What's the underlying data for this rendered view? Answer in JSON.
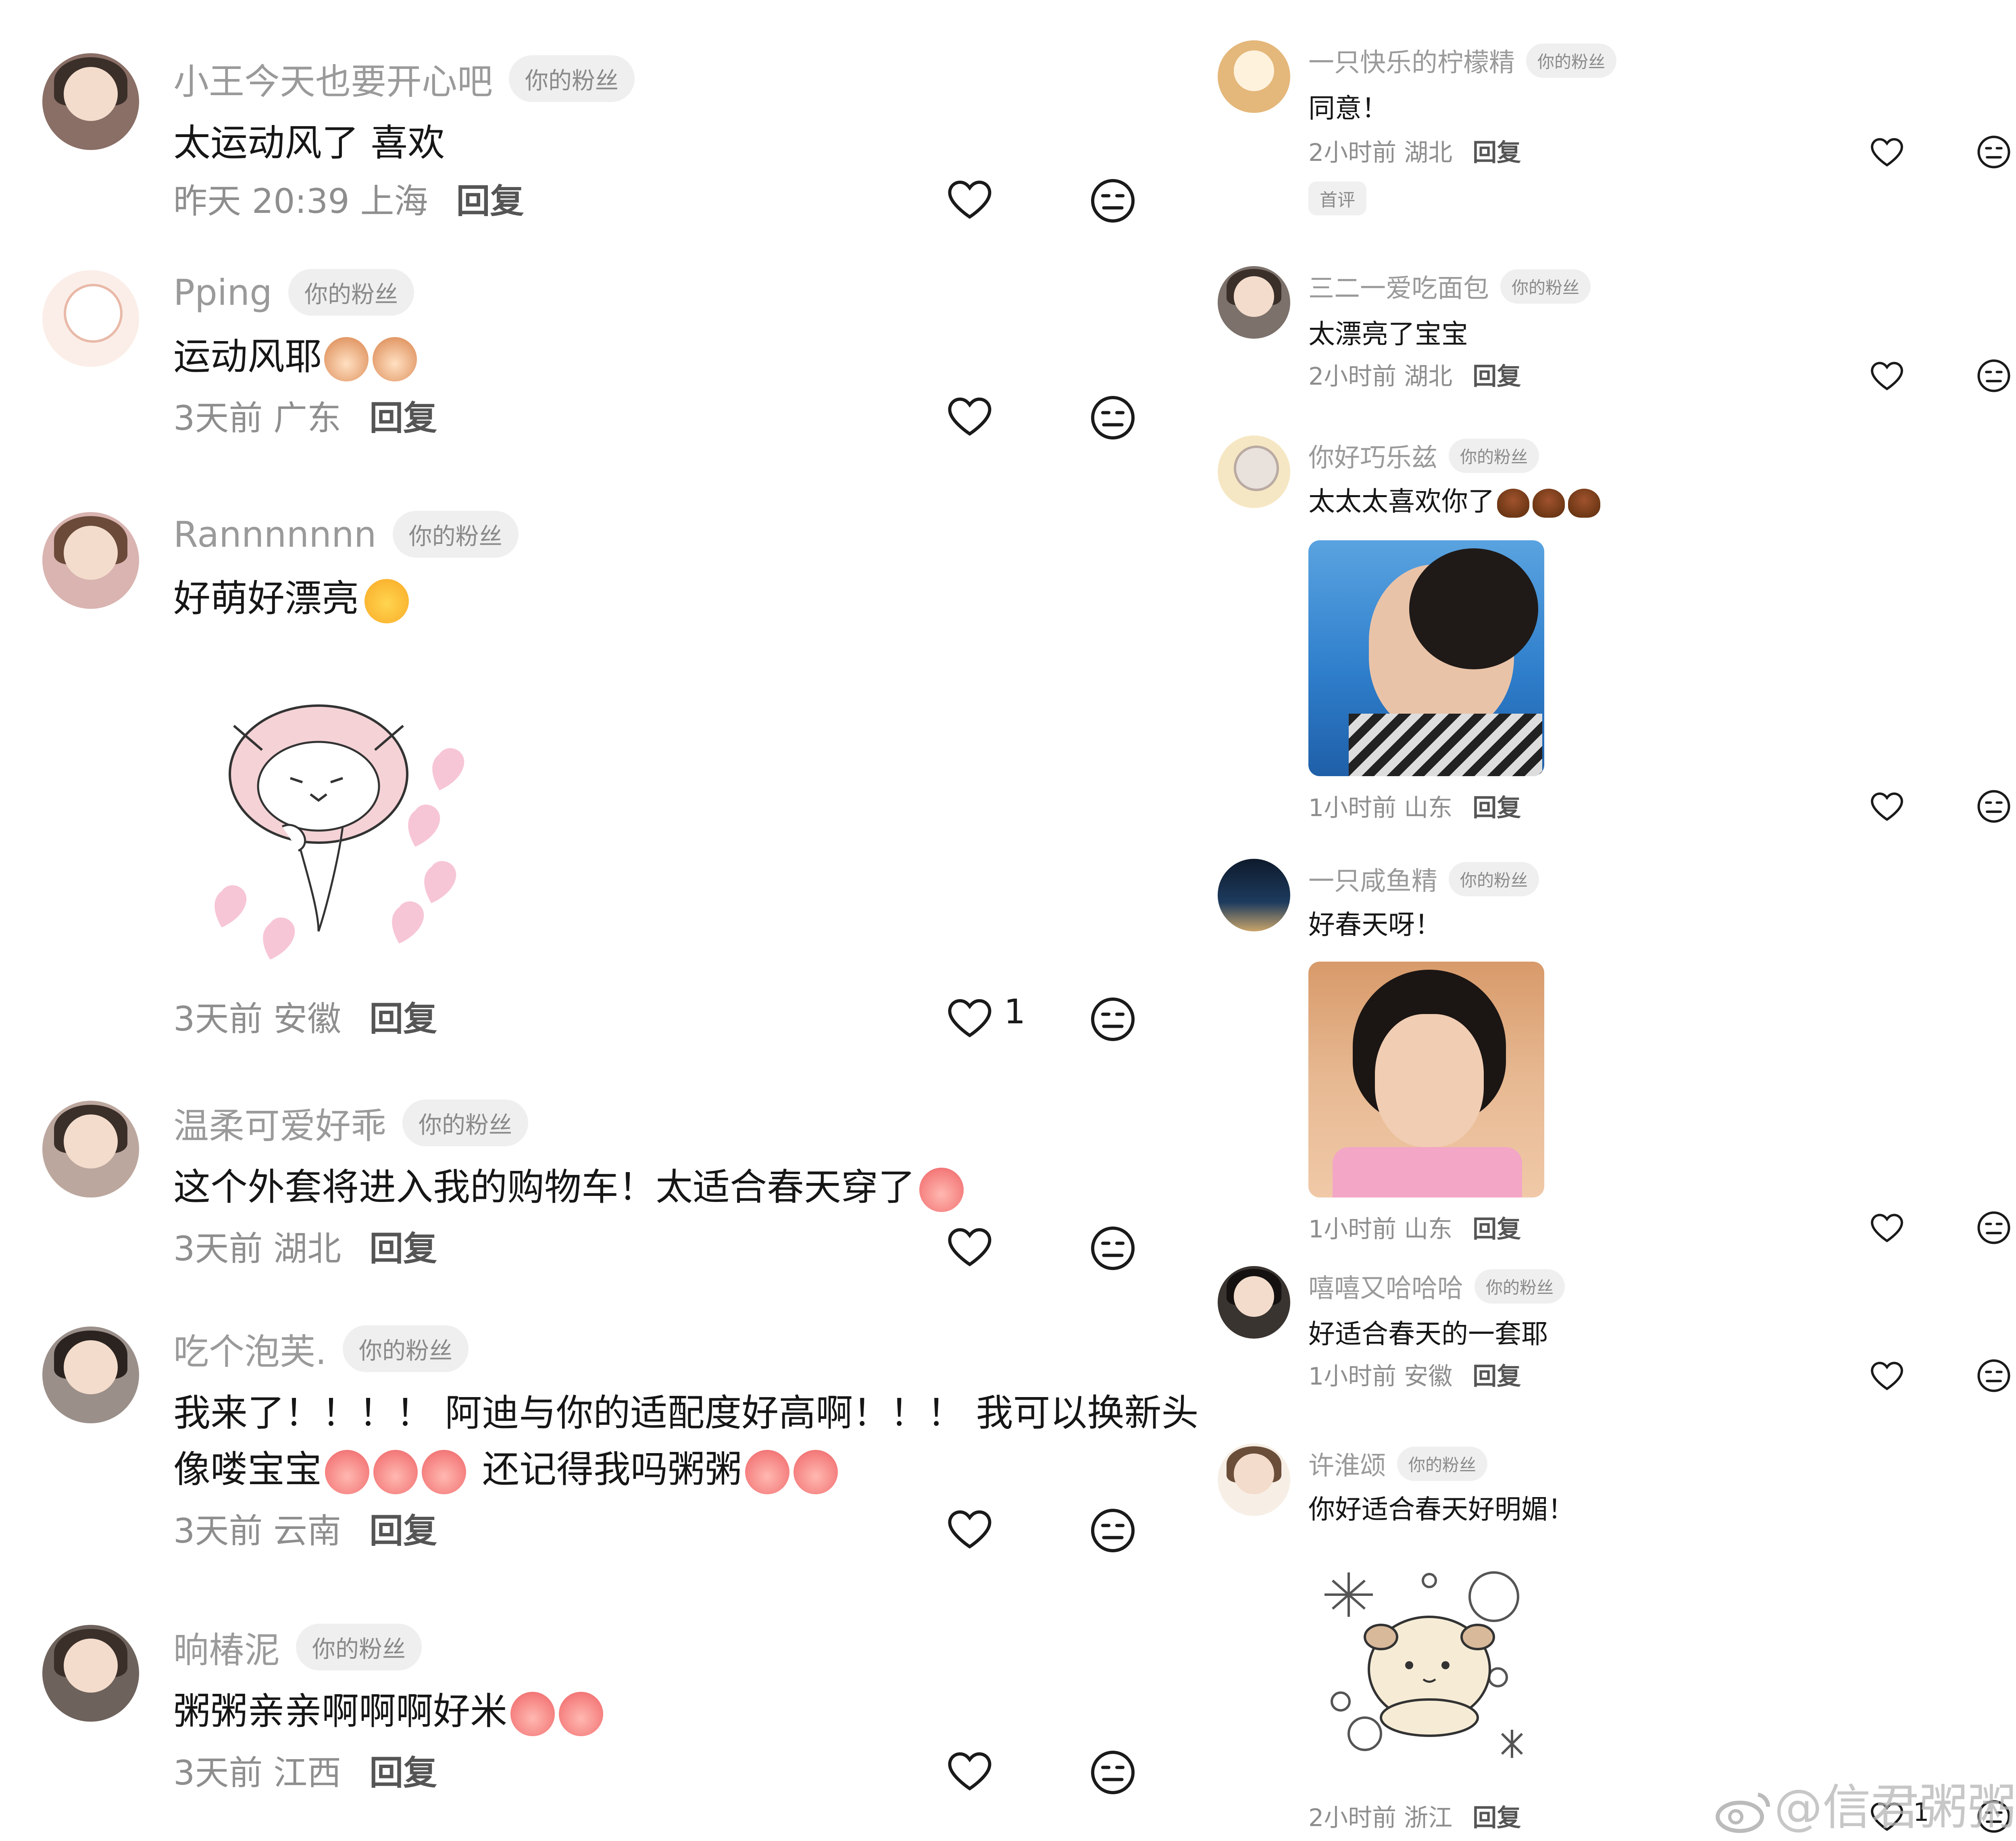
{
  "badge_label": "你的粉丝",
  "reply_label": "回复",
  "left_comments": [
    {
      "user": "小王今天也要开心吧",
      "text": "太运动风了 喜欢",
      "time": "昨天 20:39 上海",
      "likes": ""
    },
    {
      "user": "Pping",
      "text": "运动风耶",
      "time": "3天前 广东",
      "likes": ""
    },
    {
      "user": "Rannnnnnn",
      "text": "好萌好漂亮",
      "time": "3天前 安徽",
      "likes": "1"
    },
    {
      "user": "温柔可爱好乖",
      "text": "这个外套将进入我的购物车！太适合春天穿了",
      "time": "3天前 湖北",
      "likes": ""
    },
    {
      "user": "吃个泡芙.",
      "text": "我来了！！！！ 阿迪与你的适配度好高啊！！！ 我可以换新头",
      "text2": "像喽宝宝",
      "text2b": "还记得我吗粥粥",
      "time": "3天前 云南",
      "likes": ""
    },
    {
      "user": "晌椿泥",
      "text": "粥粥亲亲啊啊啊好米",
      "time": "3天前 江西",
      "likes": ""
    }
  ],
  "right_comments": [
    {
      "user": "一只快乐的柠檬精",
      "text": "同意！",
      "time": "2小时前 湖北",
      "tag": "首评"
    },
    {
      "user": "三二一爱吃面包",
      "text": "太漂亮了宝宝",
      "time": "2小时前 湖北"
    },
    {
      "user": "你好巧乐兹",
      "text": "太太太喜欢你了",
      "time": "1小时前 山东"
    },
    {
      "user": "一只咸鱼精",
      "text": "好春天呀！",
      "time": "1小时前 山东"
    },
    {
      "user": "嘻嘻又哈哈哈",
      "text": "好适合春天的一套耶",
      "time": "1小时前 安徽"
    },
    {
      "user": "许淮颂",
      "text": "你好适合春天好明媚！",
      "time": "2小时前 浙江",
      "likes": "1"
    }
  ],
  "watermark": "@信君粥粥",
  "icons": {
    "like": "heart-outline-icon",
    "dislike": "meh-face-icon"
  },
  "colors": {
    "muted": "#9a9a9a",
    "text": "#161616",
    "badge_bg": "#efefef"
  }
}
